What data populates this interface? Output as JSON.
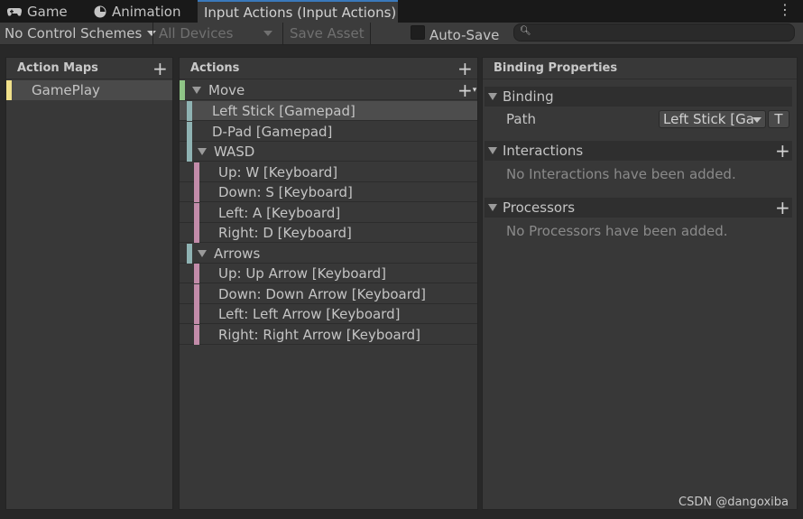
{
  "tabs": [
    {
      "label": "Game",
      "icon": "gamepad-icon"
    },
    {
      "label": "Animation",
      "icon": "animation-icon"
    },
    {
      "label": "Input Actions (Input Actions)",
      "icon": ""
    }
  ],
  "toolbar": {
    "control_schemes": "No Control Schemes",
    "devices": "All Devices",
    "save_asset": "Save Asset",
    "auto_save": "Auto-Save",
    "search_value": ""
  },
  "action_maps": {
    "header": "Action Maps",
    "items": [
      {
        "label": "GamePlay",
        "color": "#f0e08a"
      }
    ]
  },
  "actions": {
    "header": "Actions",
    "move": "Move",
    "left_stick": "Left Stick [Gamepad]",
    "dpad": "D-Pad [Gamepad]",
    "wasd": "WASD",
    "wasd_parts": [
      "Up: W [Keyboard]",
      "Down: S [Keyboard]",
      "Left: A [Keyboard]",
      "Right: D [Keyboard]"
    ],
    "arrows": "Arrows",
    "arrow_parts": [
      "Up: Up Arrow [Keyboard]",
      "Down: Down Arrow [Keyboard]",
      "Left: Left Arrow [Keyboard]",
      "Right: Right Arrow [Keyboard]"
    ],
    "colors": {
      "action": "#8fc486",
      "binding": "#8fb3b3",
      "part": "#c28ba9"
    }
  },
  "binding_properties": {
    "header": "Binding Properties",
    "binding_section": "Binding",
    "path_label": "Path",
    "path_value": "Left Stick [Ga",
    "t_button": "T",
    "interactions_section": "Interactions",
    "interactions_empty": "No Interactions have been added.",
    "processors_section": "Processors",
    "processors_empty": "No Processors have been added."
  },
  "watermark": "CSDN @dangoxiba"
}
